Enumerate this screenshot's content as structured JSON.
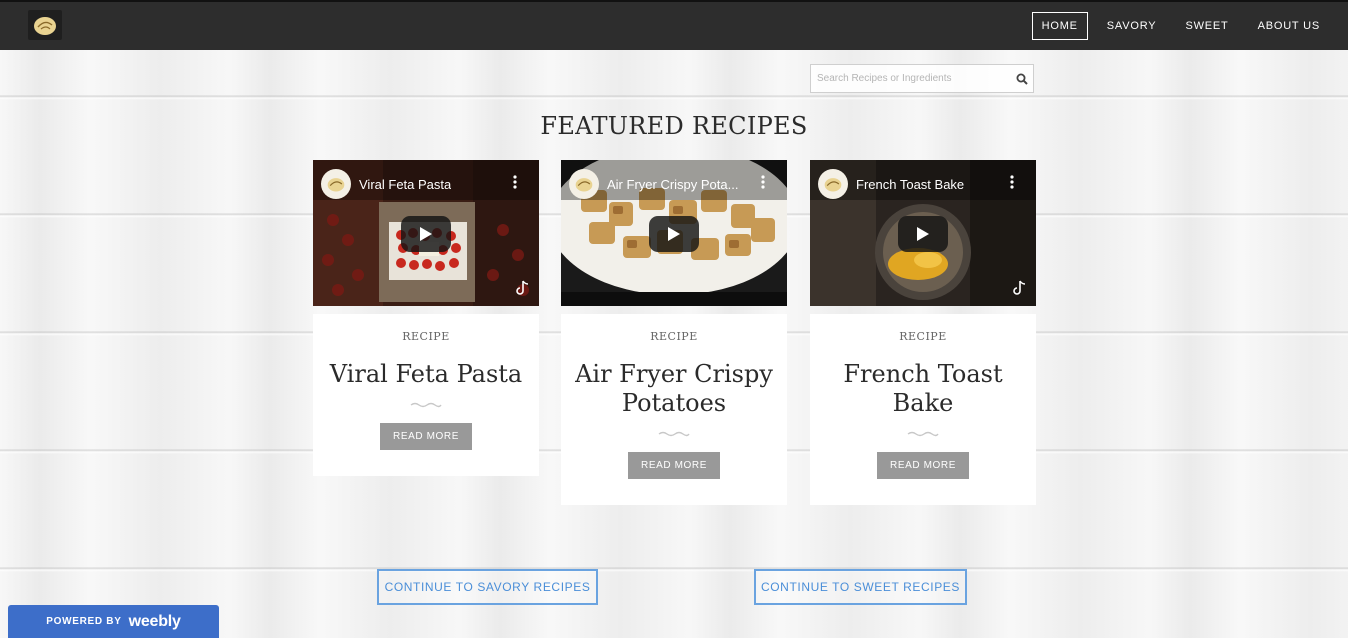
{
  "nav": {
    "items": [
      {
        "label": "HOME",
        "active": true
      },
      {
        "label": "SAVORY",
        "active": false
      },
      {
        "label": "SWEET",
        "active": false
      },
      {
        "label": "ABOUT US",
        "active": false
      }
    ]
  },
  "search": {
    "placeholder": "Search Recipes or Ingredients",
    "value": ""
  },
  "featured": {
    "heading": "FEATURED RECIPES"
  },
  "recipes": [
    {
      "video_title": "Viral Feta Pasta",
      "category": "RECIPE",
      "title": "Viral Feta Pasta",
      "button": "READ MORE"
    },
    {
      "video_title": "Air Fryer Crispy Pota...",
      "category": "RECIPE",
      "title": "Air Fryer Crispy Potatoes",
      "button": "READ MORE"
    },
    {
      "video_title": "French Toast Bake",
      "category": "RECIPE",
      "title": "French Toast Bake",
      "button": "READ MORE"
    }
  ],
  "continue": {
    "savory": "CONTINUE TO SAVORY RECIPES",
    "sweet": "CONTINUE TO SWEET RECIPES"
  },
  "footer": {
    "powered_by": "POWERED BY",
    "brand": "weebly"
  },
  "colors": {
    "topbar": "#2d2d2d",
    "accent_blue": "#4a8ed8",
    "badge_blue": "#3d6ec9",
    "button_gray": "#999999"
  }
}
